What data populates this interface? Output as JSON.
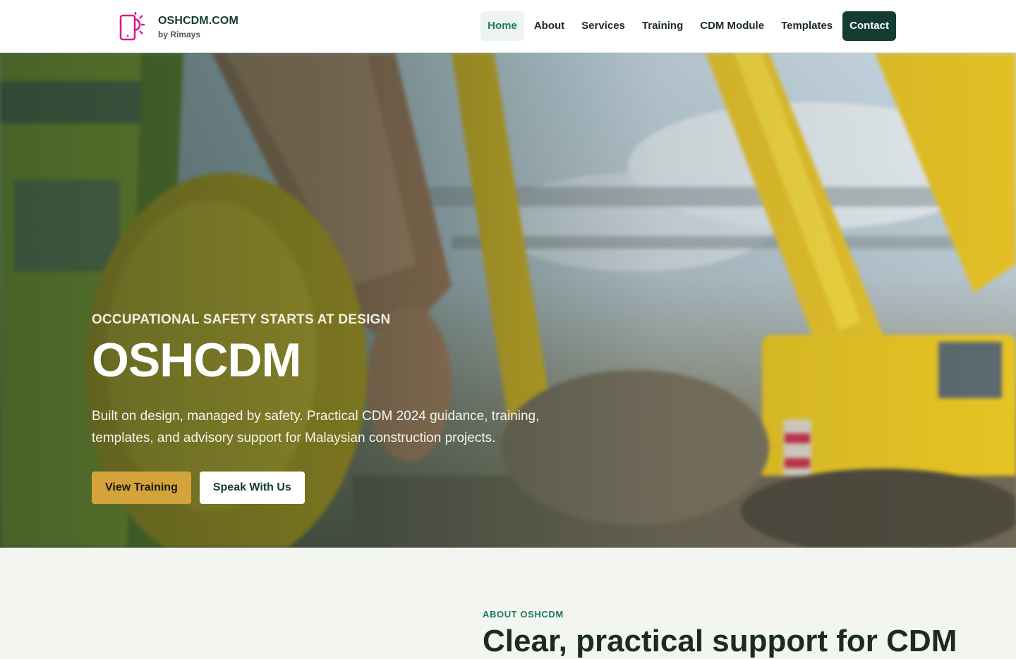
{
  "brand": {
    "name": "OSHCDM.COM",
    "subtitle": "by Rimays",
    "logo_icon": "phone-sun-icon",
    "logo_color": "#d81b8a"
  },
  "nav": {
    "items": [
      {
        "label": "Home",
        "active": true
      },
      {
        "label": "About"
      },
      {
        "label": "Services"
      },
      {
        "label": "Training"
      },
      {
        "label": "CDM Module"
      },
      {
        "label": "Templates"
      }
    ],
    "cta_label": "Contact"
  },
  "hero": {
    "eyebrow": "OCCUPATIONAL SAFETY STARTS AT DESIGN",
    "title": "OSHCDM",
    "description": "Built on design, managed by safety. Practical CDM 2024 guidance, training, templates, and advisory support for Malaysian construction projects.",
    "primary_button": "View Training",
    "secondary_button": "Speak With Us"
  },
  "about": {
    "eyebrow": "ABOUT OSHCDM",
    "heading": "Clear, practical support for CDM"
  },
  "colors": {
    "accent": "#1b7a62",
    "dark_green": "#143c33",
    "gold": "#d4a33a",
    "background": "#f3f5f0"
  }
}
